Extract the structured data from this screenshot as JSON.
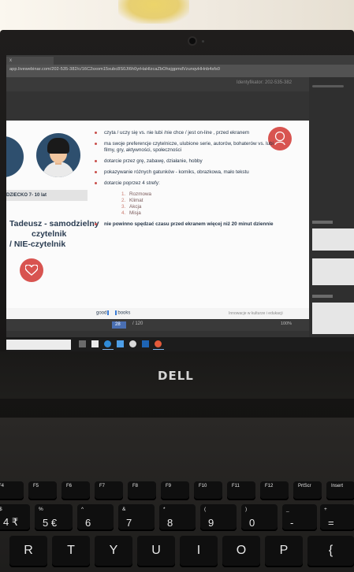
{
  "browser": {
    "tab_label": "x",
    "url": "app.livewebinar.com/202-535-382/c/16C2sxom15xubc8S0JI6h0yrHaHlzcaZbOhsjgpmdVzunqvHHnb4sfs0"
  },
  "meeting": {
    "id_label": "Identyfikator: 202-535-382"
  },
  "slide": {
    "age_label": "DZIECKO 7- 10 lat",
    "person_title": [
      "Tadeusz - samodzielny",
      "czytelnik",
      "/ NIE-czytelnik"
    ],
    "bullets": [
      {
        "text": "czyta / uczy się vs. nie lubi /nie chce / jest on-line , przed ekranem",
        "bold": false
      },
      {
        "text": "ma swoje preferencje czytelnicze, ulubione serie, autorów, bohaterów vs. lubi filmy, gry, aktywności, społeczności",
        "bold": false
      },
      {
        "text": "dotarcie przez grę, zabawę, działanie, hobby",
        "bold": false
      },
      {
        "text": "pokazywanie różnych gatunków - komiks, obrazkowa, mało tekstu",
        "bold": false
      },
      {
        "text": "dotarcie poprzez 4 strefy:",
        "bold": false
      },
      {
        "text": "nie powinno spędzać czasu przed ekranem więcej niż 20 minut dziennie",
        "bold": true
      }
    ],
    "zones": [
      "Rozmowa",
      "Klimat",
      "Akcja",
      "Misja"
    ],
    "zone_numbers": [
      "1.",
      "2.",
      "3.",
      "4."
    ],
    "logo_left": "good",
    "logo_right": "books",
    "footer_note": "Innowacje w kulturze i edukacji"
  },
  "controls": {
    "page_current": "28",
    "page_total": "/ 120",
    "zoom": "100%"
  },
  "laptop": {
    "brand": "DELL"
  },
  "keyboard": {
    "function_row": [
      "F4",
      "F5",
      "F6",
      "F7",
      "F8",
      "F9",
      "F10",
      "F11",
      "F12",
      "PrtScr",
      "Insert"
    ],
    "number_row": [
      {
        "top": "$",
        "bottom": "4 ₹"
      },
      {
        "top": "%",
        "bottom": "5 €"
      },
      {
        "top": "^",
        "bottom": "6"
      },
      {
        "top": "&",
        "bottom": "7"
      },
      {
        "top": "*",
        "bottom": "8"
      },
      {
        "top": "(",
        "bottom": "9"
      },
      {
        "top": ")",
        "bottom": "0"
      },
      {
        "top": "_",
        "bottom": "-"
      },
      {
        "top": "+",
        "bottom": "="
      }
    ],
    "letter_row": [
      "R",
      "T",
      "Y",
      "U",
      "I",
      "O",
      "P",
      "{"
    ]
  },
  "colors": {
    "accent_red": "#d85450",
    "slide_text": "#243447",
    "taskbar_underline": "#7fb2e6"
  }
}
